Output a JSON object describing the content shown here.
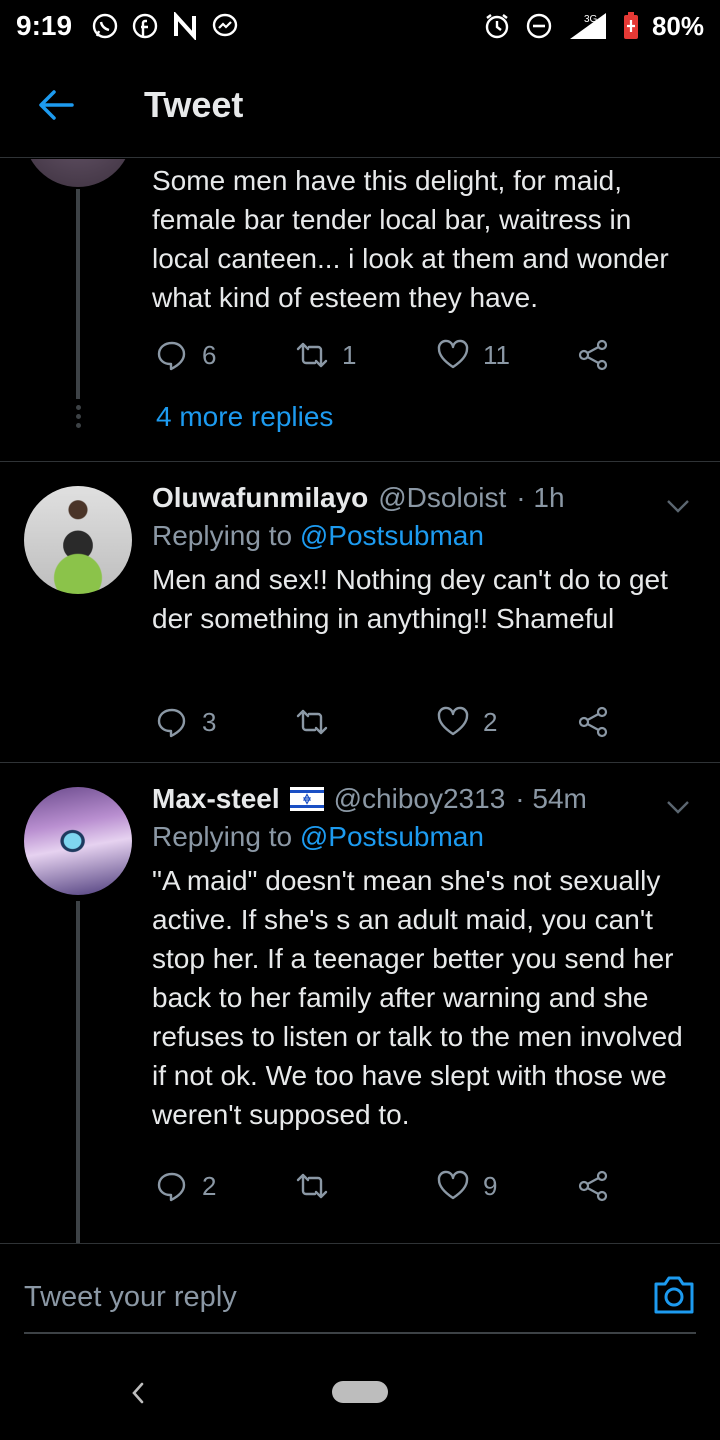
{
  "status_bar": {
    "time": "9:19",
    "network": "3G",
    "battery": "80%"
  },
  "header": {
    "title": "Tweet"
  },
  "tweets": [
    {
      "text": "Some men have this delight, for maid, female bar tender local bar, waitress in local canteen... i look at them and wonder what kind of esteem they have.",
      "replies": "6",
      "retweets": "1",
      "likes": "11",
      "more_replies": "4 more replies"
    },
    {
      "name": "Oluwafunmilayo",
      "handle": "@Dsoloist",
      "time": "· 1h",
      "replying_prefix": "Replying to",
      "replying_to": "@Postsubman",
      "text": "Men and sex!! Nothing dey can't do to get der something in anything!! Shameful",
      "replies": "3",
      "retweets": "",
      "likes": "2"
    },
    {
      "name": "Max-steel",
      "handle": "@chiboy2313",
      "time": "· 54m",
      "replying_prefix": "Replying to",
      "replying_to": "@Postsubman",
      "text": "\"A maid\" doesn't mean she's not sexually active. If she's s an adult maid, you can't stop her. If a teenager better you send her back to her family after warning and she refuses to listen or talk to the men involved if not ok. We too have slept with those we weren't supposed to.",
      "replies": "2",
      "retweets": "",
      "likes": "9"
    }
  ],
  "composer": {
    "placeholder": "Tweet your reply"
  },
  "colors": {
    "accent": "#1d9bf0",
    "background": "#000000",
    "muted": "#8b98a5"
  }
}
